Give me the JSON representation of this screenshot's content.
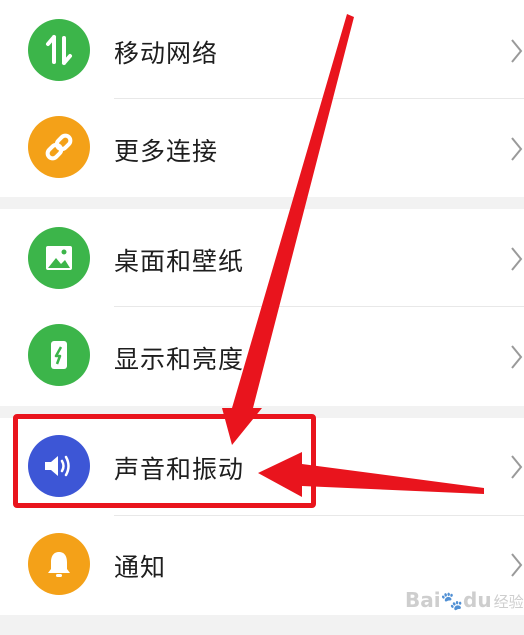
{
  "settings": {
    "items": [
      {
        "label": "移动网络",
        "icon": "mobile-data-icon",
        "color": "#3cb54a"
      },
      {
        "label": "更多连接",
        "icon": "link-icon",
        "color": "#f4a118"
      },
      {
        "label": "桌面和壁纸",
        "icon": "wallpaper-icon",
        "color": "#3cb54a"
      },
      {
        "label": "显示和亮度",
        "icon": "display-brightness-icon",
        "color": "#3cb54a"
      },
      {
        "label": "声音和振动",
        "icon": "speaker-icon",
        "color": "#3d56d6"
      },
      {
        "label": "通知",
        "icon": "bell-icon",
        "color": "#f4a118"
      }
    ]
  },
  "annotation": {
    "color": "#e9141d"
  },
  "watermark": {
    "brand_latin": "Bai",
    "brand_paw": "🐾",
    "brand_tail": "du",
    "sub": "经验"
  }
}
